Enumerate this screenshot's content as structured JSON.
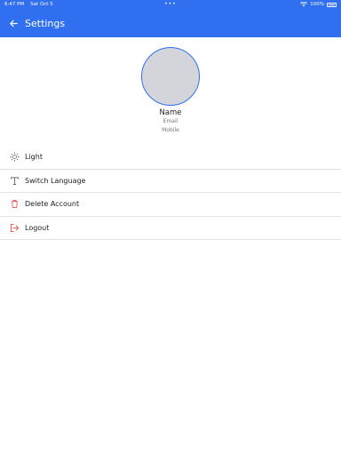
{
  "status_bar": {
    "time": "6:47 PM",
    "date": "Sat Oct 5",
    "dots": "•••",
    "battery": "100%"
  },
  "app_bar": {
    "title": "Settings",
    "back_icon": "arrow-left-icon",
    "background": "#2f6ff0"
  },
  "profile": {
    "name": "Name",
    "email": "Email",
    "mobile": "Mobile"
  },
  "menu": {
    "items": [
      {
        "label": "Light",
        "icon": "sun-icon"
      },
      {
        "label": "Switch Language",
        "icon": "text-icon"
      },
      {
        "label": "Delete Account",
        "icon": "trash-icon",
        "icon_color": "#e53935"
      },
      {
        "label": "Logout",
        "icon": "logout-icon",
        "icon_color": "#e53935"
      }
    ]
  }
}
